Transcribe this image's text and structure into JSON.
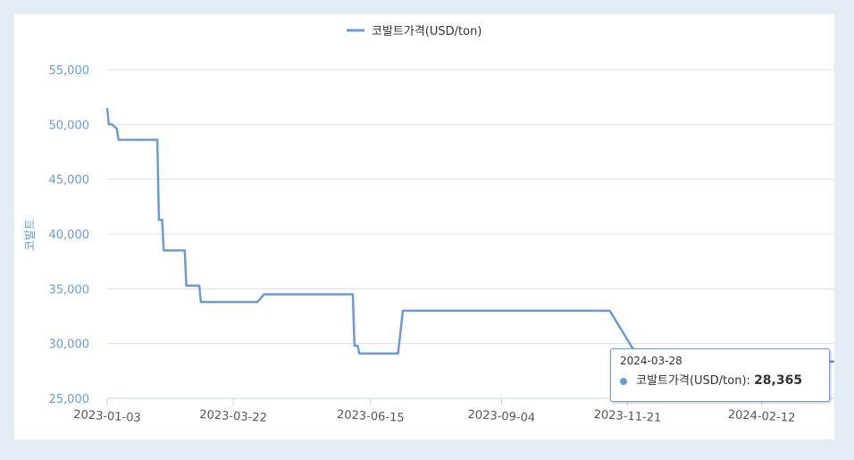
{
  "chart_data": {
    "type": "line",
    "title": "",
    "xlabel": "",
    "ylabel": "코발트",
    "ylim": [
      25000,
      55000
    ],
    "yticks": [
      25000,
      30000,
      35000,
      40000,
      45000,
      50000,
      55000
    ],
    "ytick_labels": [
      "25,000",
      "30,000",
      "35,000",
      "40,000",
      "45,000",
      "50,000",
      "55,000"
    ],
    "xticks": [
      "2023-01-03",
      "2023-03-22",
      "2023-06-15",
      "2023-09-04",
      "2023-11-21",
      "2024-02-12"
    ],
    "grid": true,
    "legend_position": "top-center",
    "series": [
      {
        "name": "코발트가격(USD/ton)",
        "color": "#6a9bd8",
        "points": [
          [
            "2023-01-03",
            51500
          ],
          [
            "2023-01-04",
            50000
          ],
          [
            "2023-01-06",
            50000
          ],
          [
            "2023-01-09",
            49600
          ],
          [
            "2023-01-10",
            48600
          ],
          [
            "2023-01-20",
            48600
          ],
          [
            "2023-02-01",
            48600
          ],
          [
            "2023-02-03",
            48600
          ],
          [
            "2023-02-04",
            41300
          ],
          [
            "2023-02-06",
            41300
          ],
          [
            "2023-02-07",
            38500
          ],
          [
            "2023-02-20",
            38500
          ],
          [
            "2023-02-21",
            35300
          ],
          [
            "2023-03-01",
            35300
          ],
          [
            "2023-03-02",
            33800
          ],
          [
            "2023-04-06",
            33800
          ],
          [
            "2023-04-10",
            34500
          ],
          [
            "2023-06-04",
            34500
          ],
          [
            "2023-06-05",
            29800
          ],
          [
            "2023-06-07",
            29800
          ],
          [
            "2023-06-08",
            29100
          ],
          [
            "2023-07-02",
            29100
          ],
          [
            "2023-07-05",
            33000
          ],
          [
            "2023-11-09",
            33000
          ],
          [
            "2023-11-10",
            33000
          ],
          [
            "2023-11-29",
            28400
          ],
          [
            "2024-03-28",
            28365
          ]
        ]
      }
    ],
    "tooltip": {
      "date": "2024-03-28",
      "series_name": "코발트가격(USD/ton):",
      "value": "28,365"
    }
  }
}
